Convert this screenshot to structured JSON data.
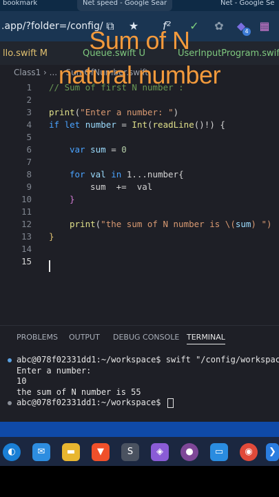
{
  "browser": {
    "tabs": [
      "bookmark",
      "Net speed - Google Sear",
      "Net - Google Se"
    ],
    "url": ".app/?folder=/config/",
    "badge_count": "4"
  },
  "editor": {
    "tabs": [
      {
        "label": "llo.swift",
        "status": "M"
      },
      {
        "label": "Queue.swift",
        "status": "U"
      },
      {
        "label": "UserInputProgram.swift",
        "status": "U"
      }
    ],
    "breadcrumb": "Class1 › ... › SumOfNumber.swift",
    "line_numbers": [
      "1",
      "2",
      "3",
      "4",
      "5",
      "6",
      "7",
      "8",
      "9",
      "10",
      "11",
      "12",
      "13",
      "14",
      "15"
    ],
    "code": {
      "l1": "// Sum of first N number :",
      "l3_fn": "print",
      "l3_str": "\"Enter a number: \"",
      "l4_kw1": "if let",
      "l4_var": "number",
      "l4_op": " = ",
      "l4_type": "Int",
      "l4_fn": "readLine",
      "l4_rest": "()!) {",
      "l6_kw": "var",
      "l6_var": "sum",
      "l6_op": " = ",
      "l6_num": "0",
      "l8_kw1": "for",
      "l8_var": "val",
      "l8_kw2": "in",
      "l8_range": "1...number{",
      "l9": "sum  +=  val",
      "l10": "}",
      "l12_fn": "print",
      "l12_str1": "\"the sum of N number is \\(",
      "l12_var": "sum",
      "l12_str2": ") \")",
      "l13": "}"
    }
  },
  "overlay": {
    "line1": "Sum of N",
    "line2": "natural number"
  },
  "panel": {
    "tabs": [
      "PROBLEMS",
      "OUTPUT",
      "DEBUG CONSOLE",
      "TERMINAL"
    ],
    "terminal": [
      "abc@078f02331dd1:~/workspace$ swift \"/config/workspac",
      "Enter a number:",
      "10",
      "the sum of N number is 55",
      "abc@078f02331dd1:~/workspace$"
    ]
  },
  "taskbar": {
    "icons": [
      "edge-icon",
      "mail-icon",
      "file-explorer-icon",
      "brave-icon",
      "sublime-icon",
      "visual-studio-icon",
      "webcam-icon",
      "tor-icon",
      "monitor-icon",
      "chrome-icon",
      "vscode-icon"
    ]
  },
  "colors": {
    "accent": "#f39a3c",
    "editor_bg": "#1e1f26",
    "statusbar": "#0f4aa8"
  }
}
